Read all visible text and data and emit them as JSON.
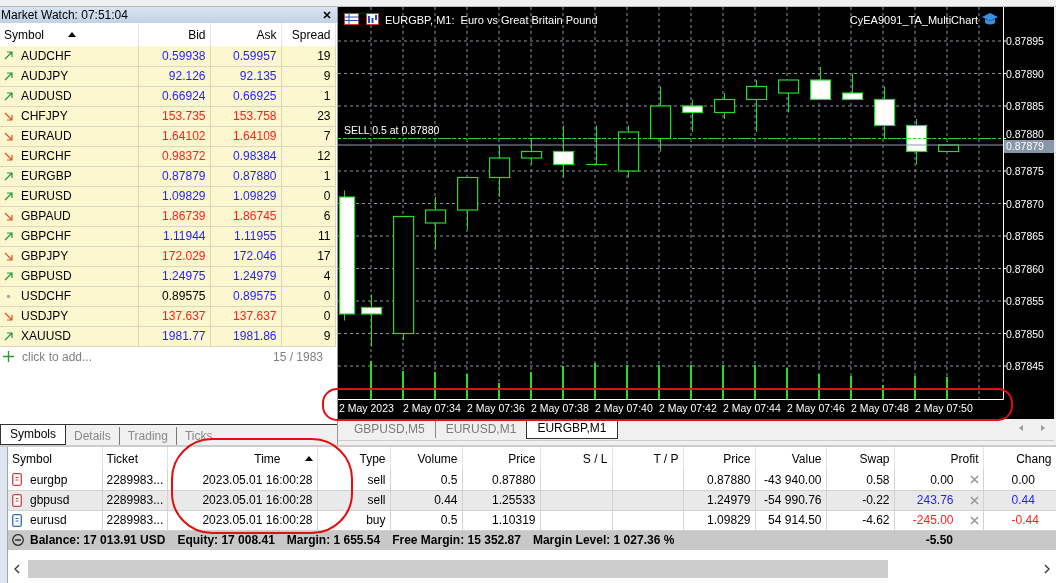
{
  "market_watch": {
    "title": "Market Watch: 07:51:04",
    "columns": [
      {
        "label": "Symbol",
        "sorted": true
      },
      {
        "label": "Bid",
        "sorted": false
      },
      {
        "label": "Ask",
        "sorted": false
      },
      {
        "label": "Spread",
        "sorted": false
      }
    ],
    "rows": [
      {
        "symbol": "AUDCHF",
        "bid": "0.59938",
        "ask": "0.59957",
        "spread": "19",
        "rising": true,
        "falling": false,
        "bid_up": true,
        "bid_down": false,
        "ask_up": true,
        "ask_down": false
      },
      {
        "symbol": "AUDJPY",
        "bid": "92.126",
        "ask": "92.135",
        "spread": "9",
        "rising": true,
        "falling": false,
        "bid_up": true,
        "bid_down": false,
        "ask_up": true,
        "ask_down": false
      },
      {
        "symbol": "AUDUSD",
        "bid": "0.66924",
        "ask": "0.66925",
        "spread": "1",
        "rising": true,
        "falling": false,
        "bid_up": true,
        "bid_down": false,
        "ask_up": true,
        "ask_down": false
      },
      {
        "symbol": "CHFJPY",
        "bid": "153.735",
        "ask": "153.758",
        "spread": "23",
        "rising": false,
        "falling": true,
        "bid_up": false,
        "bid_down": true,
        "ask_up": false,
        "ask_down": true
      },
      {
        "symbol": "EURAUD",
        "bid": "1.64102",
        "ask": "1.64109",
        "spread": "7",
        "rising": false,
        "falling": true,
        "bid_up": false,
        "bid_down": true,
        "ask_up": false,
        "ask_down": true
      },
      {
        "symbol": "EURCHF",
        "bid": "0.98372",
        "ask": "0.98384",
        "spread": "12",
        "rising": false,
        "falling": true,
        "bid_up": false,
        "bid_down": true,
        "ask_up": true,
        "ask_down": false
      },
      {
        "symbol": "EURGBP",
        "bid": "0.87879",
        "ask": "0.87880",
        "spread": "1",
        "rising": true,
        "falling": false,
        "bid_up": true,
        "bid_down": false,
        "ask_up": true,
        "ask_down": false
      },
      {
        "symbol": "EURUSD",
        "bid": "1.09829",
        "ask": "1.09829",
        "spread": "0",
        "rising": true,
        "falling": false,
        "bid_up": true,
        "bid_down": false,
        "ask_up": true,
        "ask_down": false
      },
      {
        "symbol": "GBPAUD",
        "bid": "1.86739",
        "ask": "1.86745",
        "spread": "6",
        "rising": false,
        "falling": true,
        "bid_up": false,
        "bid_down": true,
        "ask_up": false,
        "ask_down": true
      },
      {
        "symbol": "GBPCHF",
        "bid": "1.11944",
        "ask": "1.11955",
        "spread": "11",
        "rising": true,
        "falling": false,
        "bid_up": true,
        "bid_down": false,
        "ask_up": true,
        "ask_down": false
      },
      {
        "symbol": "GBPJPY",
        "bid": "172.029",
        "ask": "172.046",
        "spread": "17",
        "rising": false,
        "falling": true,
        "bid_up": false,
        "bid_down": true,
        "ask_up": true,
        "ask_down": false
      },
      {
        "symbol": "GBPUSD",
        "bid": "1.24975",
        "ask": "1.24979",
        "spread": "4",
        "rising": true,
        "falling": false,
        "bid_up": true,
        "bid_down": false,
        "ask_up": true,
        "ask_down": false
      },
      {
        "symbol": "USDCHF",
        "bid": "0.89575",
        "ask": "0.89575",
        "spread": "0",
        "rising": false,
        "falling": false,
        "bid_up": false,
        "bid_down": false,
        "ask_up": true,
        "ask_down": false
      },
      {
        "symbol": "USDJPY",
        "bid": "137.637",
        "ask": "137.637",
        "spread": "0",
        "rising": false,
        "falling": true,
        "bid_up": false,
        "bid_down": true,
        "ask_up": false,
        "ask_down": true
      },
      {
        "symbol": "XAUUSD",
        "bid": "1981.77",
        "ask": "1981.86",
        "spread": "9",
        "rising": true,
        "falling": false,
        "bid_up": true,
        "bid_down": false,
        "ask_up": true,
        "ask_down": false
      }
    ],
    "add_label": "click to add...",
    "count": "15 / 1983",
    "tabs": [
      {
        "label": "Symbols",
        "selected": true
      },
      {
        "label": "Details",
        "selected": false
      },
      {
        "label": "Trading",
        "selected": false
      },
      {
        "label": "Ticks",
        "selected": false
      }
    ]
  },
  "chart": {
    "title": "EURGBP, M1:  Euro vs Great Britain Pound",
    "expert": "CyEA9091_TA_MultiChart",
    "order_line": "SELL 0.5 at 0.87880",
    "bid_label": "0.87879",
    "price_labels": [
      "0.87895",
      "0.87890",
      "0.87885",
      "0.87880",
      "0.87875",
      "0.87870",
      "0.87865",
      "0.87860",
      "0.87855",
      "0.87850",
      "0.87845"
    ],
    "time_labels": [
      "2 May 2023",
      "2 May 07:34",
      "2 May 07:36",
      "2 May 07:38",
      "2 May 07:40",
      "2 May 07:42",
      "2 May 07:44",
      "2 May 07:46",
      "2 May 07:48",
      "2 May 07:50"
    ]
  },
  "chart_tabs": [
    {
      "label": "GBPUSD,M5",
      "selected": false
    },
    {
      "label": "EURUSD,M1",
      "selected": false
    },
    {
      "label": "EURGBP,M1",
      "selected": true
    }
  ],
  "terminal": {
    "columns": [
      {
        "label": "Symbol",
        "sorted": false
      },
      {
        "label": "Ticket",
        "sorted": false
      },
      {
        "label": "Time",
        "sorted": true
      },
      {
        "label": "Type",
        "sorted": false
      },
      {
        "label": "Volume",
        "sorted": false
      },
      {
        "label": "Price",
        "sorted": false
      },
      {
        "label": "S / L",
        "sorted": false
      },
      {
        "label": "T / P",
        "sorted": false
      },
      {
        "label": "Price",
        "sorted": false
      },
      {
        "label": "Value",
        "sorted": false
      },
      {
        "label": "Swap",
        "sorted": false
      },
      {
        "label": "Profit",
        "sorted": false
      },
      {
        "label": "Chang",
        "sorted": false
      }
    ],
    "rows": [
      {
        "symbol": "eurgbp",
        "ticket": "2289983...",
        "time": "2023.05.01 16:00:28",
        "type": "sell",
        "volume": "0.5",
        "price": "0.87880",
        "current_price": "0.87880",
        "value": "-43 940.00",
        "swap": "0.58",
        "profit": "0.00",
        "change": "0.00",
        "gain": false,
        "loss": false,
        "selected": false
      },
      {
        "symbol": "gbpusd",
        "ticket": "2289983...",
        "time": "2023.05.01 16:00:28",
        "type": "sell",
        "volume": "0.44",
        "price": "1.25533",
        "current_price": "1.24979",
        "value": "-54 990.76",
        "swap": "-0.22",
        "profit": "243.76",
        "change": "0.44",
        "gain": true,
        "loss": false,
        "selected": true
      },
      {
        "symbol": "eurusd",
        "ticket": "2289983...",
        "time": "2023.05.01 16:00:28",
        "type": "buy",
        "volume": "0.5",
        "price": "1.10319",
        "current_price": "1.09829",
        "value": "54 914.50",
        "swap": "-4.62",
        "profit": "-245.00",
        "change": "-0.44",
        "gain": false,
        "loss": true,
        "selected": false
      }
    ],
    "summary": [
      "Balance: 17 013.91 USD",
      "Equity: 17 008.41",
      "Margin: 1 655.54",
      "Free Margin: 15 352.87",
      "Margin Level: 1 027.36 %"
    ],
    "total_profit": "-5.50"
  }
}
